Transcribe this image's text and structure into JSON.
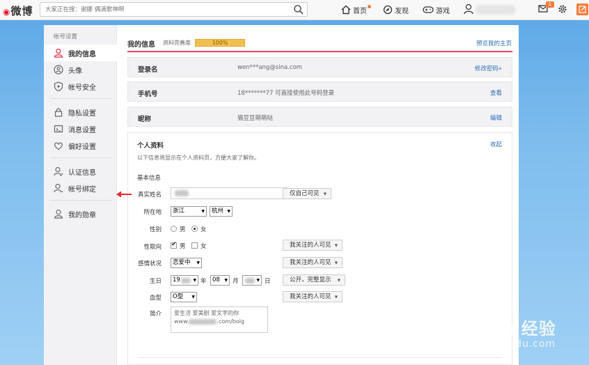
{
  "topbar": {
    "logo": "微博",
    "search_placeholder": "大家正在搜：谢娜 偶滴歌神啊",
    "nav_home": "首页",
    "nav_discover": "发现",
    "nav_game": "游戏",
    "mail_badge": "1"
  },
  "sidebar": {
    "title": "帐号设置",
    "items": [
      {
        "label": "我的信息",
        "icon": "user-icon"
      },
      {
        "label": "头像",
        "icon": "avatar-icon"
      },
      {
        "label": "帐号安全",
        "icon": "shield-icon"
      },
      {
        "label": "隐私设置",
        "icon": "lock-icon"
      },
      {
        "label": "消息设置",
        "icon": "message-icon"
      },
      {
        "label": "偏好设置",
        "icon": "heart-icon"
      },
      {
        "label": "认证信息",
        "icon": "verify-icon"
      },
      {
        "label": "帐号绑定",
        "icon": "bind-icon"
      },
      {
        "label": "我的勋章",
        "icon": "medal-icon"
      }
    ]
  },
  "main": {
    "title": "我的信息",
    "progress_label": "资料完善度",
    "progress_value": "100%",
    "progress_fraction": 1.0,
    "preview_link": "预览我的主页",
    "rows": [
      {
        "label": "登录名",
        "value": "wen***ang@sina.com",
        "action": "修改密码»"
      },
      {
        "label": "手机号",
        "value": "18*******77 可直接使用此号码登录",
        "action": "查看"
      },
      {
        "label": "昵称",
        "value": "猫豆豆萌萌哒",
        "action": "编辑"
      }
    ],
    "profile": {
      "title": "个人资料",
      "collapse": "收起",
      "desc": "以下信息将显示在个人资料页，方便大家了解你。",
      "basic": "基本信息",
      "realname_label": "真实姓名",
      "realname_vis": "仅自己可见",
      "location_label": "所在地",
      "province": "浙江",
      "city": "杭州",
      "gender_label": "性别",
      "gender_male": "男",
      "gender_female": "女",
      "orientation_label": "性取向",
      "orient_male": "男",
      "orient_female": "女",
      "orientation_vis": "我关注的人可见",
      "relationship_label": "感情状况",
      "relationship": "恋爱中",
      "relationship_vis": "我关注的人可见",
      "birthday_label": "生日",
      "birth_year": "19",
      "year_unit": "年",
      "birth_month": "08",
      "month_unit": "月",
      "day_unit": "日",
      "birthday_vis": "公开，完整显示",
      "blood_label": "血型",
      "blood": "O型",
      "blood_vis": "我关注的人可见",
      "intro_label": "简介",
      "intro_line1": "爱生活 爱美剧 爱文字的你",
      "intro_line2_prefix": "www.",
      "intro_line2_suffix": ".com/bolg"
    }
  },
  "watermark": {
    "main": "Bai du 经验",
    "sub": "jingyan.baidu.com"
  },
  "colors": {
    "accent_red": "#e0475a",
    "link_blue": "#2f6fb3",
    "progress_gold": "#f0c050",
    "orange": "#fa7d3c"
  }
}
